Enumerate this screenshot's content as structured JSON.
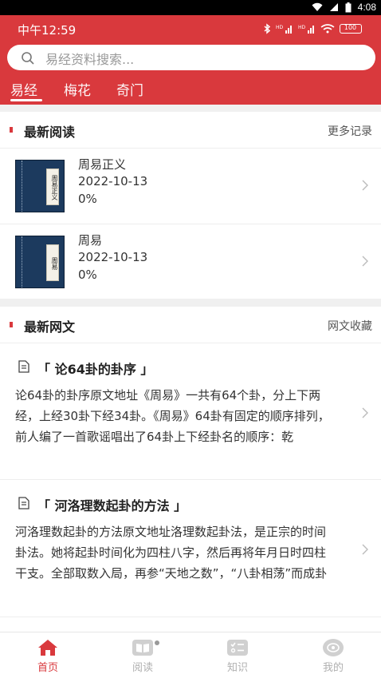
{
  "system_bar": {
    "time": "4:08"
  },
  "phone_bar": {
    "time": "中午12:59",
    "battery": "100"
  },
  "search": {
    "placeholder": "易经资料搜索..."
  },
  "tabs": [
    {
      "label": "易经",
      "active": true
    },
    {
      "label": "梅花",
      "active": false
    },
    {
      "label": "奇门",
      "active": false
    }
  ],
  "recent_reading": {
    "title": "最新阅读",
    "more": "更多记录",
    "books": [
      {
        "title": "周易正义",
        "date": "2022-10-13",
        "progress": "0%",
        "cover_label": "周易正义"
      },
      {
        "title": "周易",
        "date": "2022-10-13",
        "progress": "0%",
        "cover_label": "周易"
      }
    ]
  },
  "recent_articles": {
    "title": "最新网文",
    "more": "网文收藏",
    "items": [
      {
        "title": "「 论64卦的卦序 」",
        "body": "论64卦的卦序原文地址《周易》一共有64个卦，分上下两经，上经30卦下经34卦。《周易》64卦有固定的顺序排列，前人编了一首歌谣唱出了64卦上下经卦名的顺序：乾"
      },
      {
        "title": "「 河洛理数起卦的方法 」",
        "body": "河洛理数起卦的方法原文地址洛理数起卦法，是正宗的时间卦法。她将起卦时间化为四柱八字，然后再将年月日时四柱干支。全部取数入局，再参“天地之数”，“八卦相荡”而成卦"
      }
    ]
  },
  "bottom_nav": [
    {
      "label": "首页",
      "icon": "home-icon",
      "active": true
    },
    {
      "label": "阅读",
      "icon": "book-icon",
      "active": false
    },
    {
      "label": "知识",
      "icon": "knowledge-icon",
      "active": false
    },
    {
      "label": "我的",
      "icon": "profile-icon",
      "active": false
    }
  ],
  "colors": {
    "accent": "#d9393d",
    "inactive": "#b0b0b0"
  }
}
